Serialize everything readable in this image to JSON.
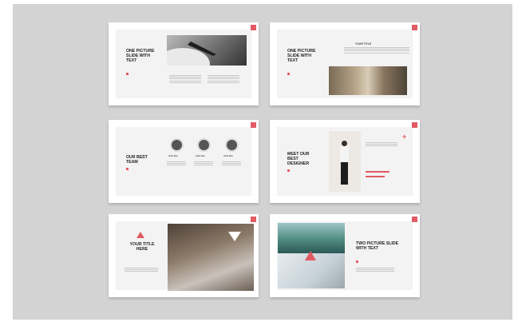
{
  "slides": [
    {
      "title": "ONE PICTURE SLIDE WITH TEXT"
    },
    {
      "title": "ONE PICTURE SLIDE WITH TEXT",
      "subtitle": "YOUR TITLE"
    },
    {
      "title": "OUR BEST TEAM",
      "members": [
        "John Doe",
        "John Doe",
        "John Doe"
      ]
    },
    {
      "title": "MEET OUR BEST DESIGNER"
    },
    {
      "title": "YOUR TITLE HERE"
    },
    {
      "title": "TWO PICTURE SLIDE WITH TEXT"
    }
  ],
  "colors": {
    "accent": "#e25a63",
    "background": "#d3d3d3"
  }
}
